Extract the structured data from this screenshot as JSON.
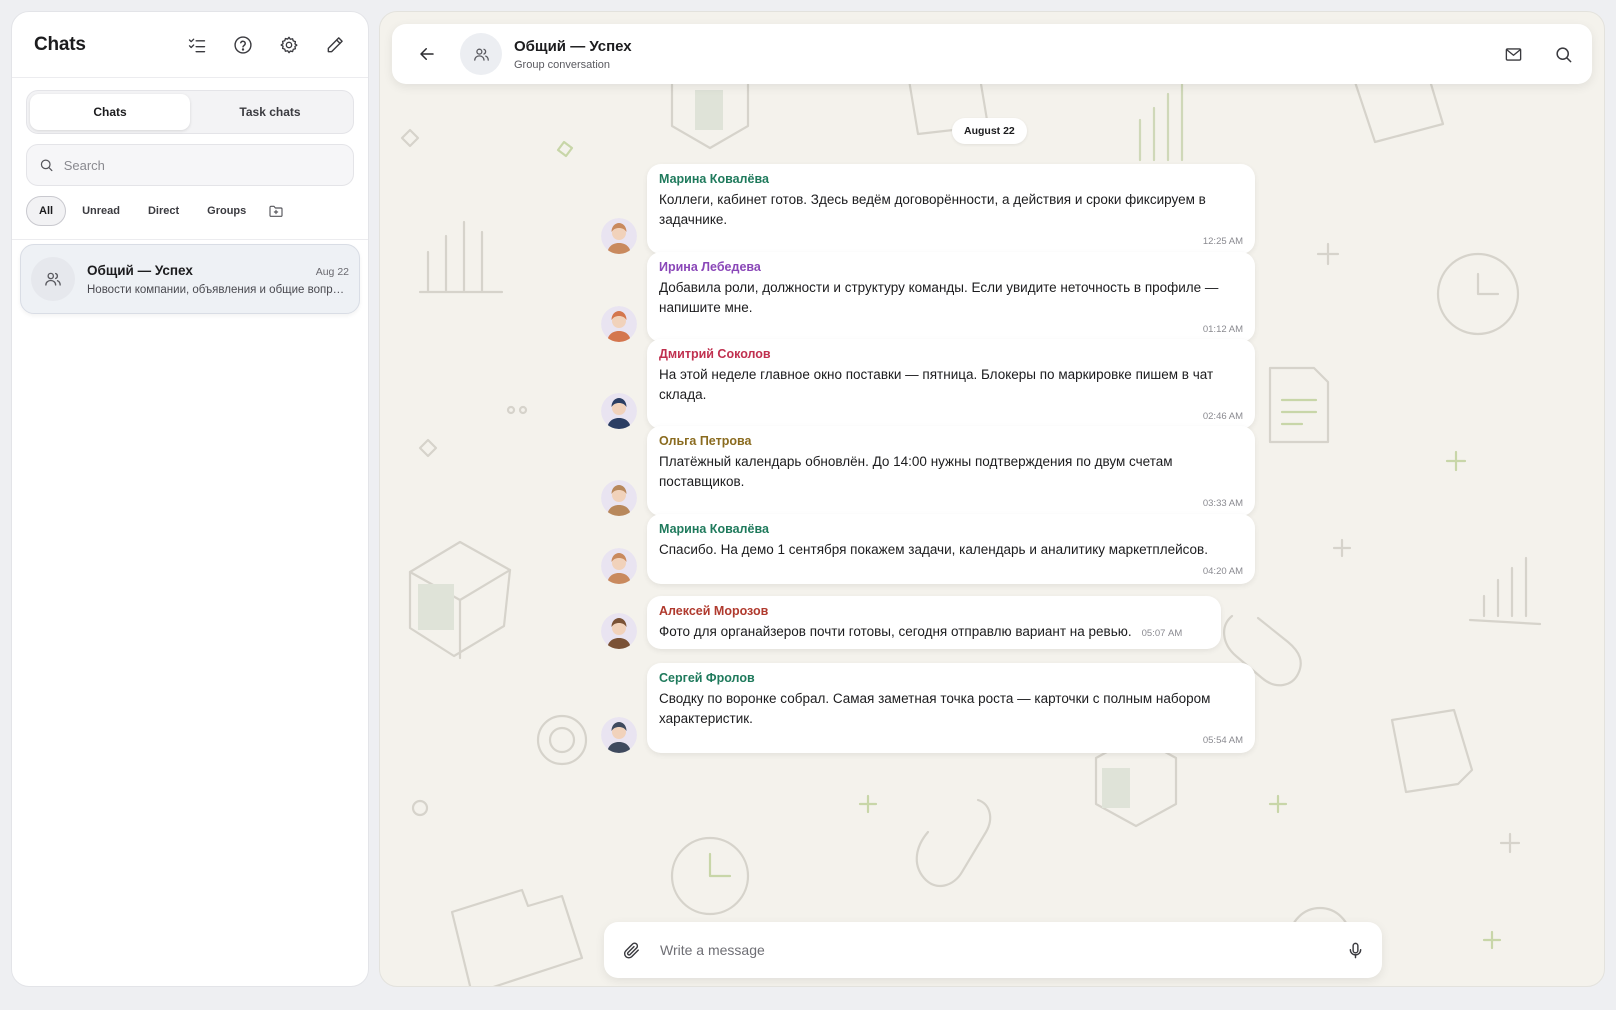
{
  "sidebar": {
    "title": "Chats",
    "icons": [
      "checklist-icon",
      "help-icon",
      "settings-icon",
      "compose-icon"
    ],
    "segments": [
      {
        "label": "Chats",
        "active": true
      },
      {
        "label": "Task chats",
        "active": false
      }
    ],
    "search": {
      "placeholder": "Search",
      "value": ""
    },
    "filters": [
      {
        "label": "All",
        "active": true
      },
      {
        "label": "Unread",
        "active": false
      },
      {
        "label": "Direct",
        "active": false
      },
      {
        "label": "Groups",
        "active": false
      }
    ],
    "chats": [
      {
        "name": "Общий — Успех",
        "date": "Aug 22",
        "preview": "Новости компании, объявления и общие вопросы"
      }
    ]
  },
  "conversation": {
    "title": "Общий — Успех",
    "subtitle": "Group conversation",
    "date_divider": "August 22",
    "messages": [
      {
        "sender": "Марина Ковалёва",
        "sender_color": "#1f7a5c",
        "avatar_color": "#c98a5e",
        "text": "Коллеги, кабинет готов. Здесь ведём договорённости, а действия и сроки фиксируем в задачнике.",
        "time": "12:25 AM"
      },
      {
        "sender": "Ирина Лебедева",
        "sender_color": "#8a47b8",
        "avatar_color": "#d4764e",
        "text": "Добавила роли, должности и структуру команды. Если увидите неточность в профиле — напишите мне.",
        "time": "01:12 AM"
      },
      {
        "sender": "Дмитрий Соколов",
        "sender_color": "#c0304f",
        "avatar_color": "#2b3e63",
        "text": "На этой неделе главное окно поставки — пятница. Блокеры по маркировке пишем в чат склада.",
        "time": "02:46 AM"
      },
      {
        "sender": "Ольга Петрова",
        "sender_color": "#8a6b1f",
        "avatar_color": "#b8885c",
        "text": "Платёжный календарь обновлён. До 14:00 нужны подтверждения по двум счетам поставщиков.",
        "time": "03:33 AM"
      },
      {
        "sender": "Марина Ковалёва",
        "sender_color": "#1f7a5c",
        "avatar_color": "#c98a5e",
        "text": "Спасибо. На демо 1 сентября покажем задачи, календарь и аналитику маркетплейсов.",
        "time": "04:20 AM"
      },
      {
        "sender": "Алексей Морозов",
        "sender_color": "#b03a2e",
        "avatar_color": "#7a5236",
        "text": "Фото для органайзеров почти готовы, сегодня отправлю вариант на ревью.",
        "time": "05:07 AM"
      },
      {
        "sender": "Сергей Фролов",
        "sender_color": "#1f7a5c",
        "avatar_color": "#3f4a5e",
        "text": "Сводку по воронке собрал. Самая заметная точка роста — карточки с полным набором характеристик.",
        "time": "05:54 AM"
      }
    ],
    "composer": {
      "placeholder": "Write a message",
      "value": ""
    }
  }
}
